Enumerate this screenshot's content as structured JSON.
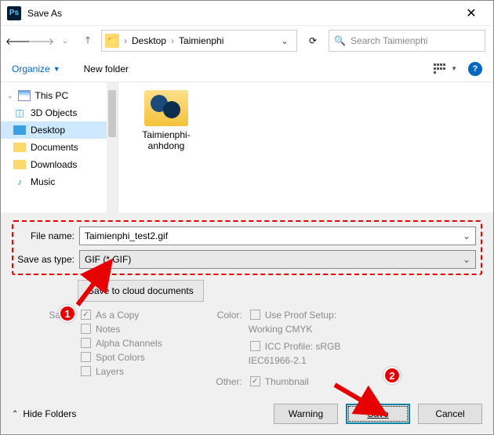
{
  "titlebar": {
    "title": "Save As",
    "app_abbr": "Ps"
  },
  "nav": {
    "breadcrumb": [
      "Desktop",
      "Taimienphi"
    ],
    "search_placeholder": "Search Taimienphi"
  },
  "toolbar": {
    "organize": "Organize",
    "new_folder": "New folder"
  },
  "sidebar": {
    "root": "This PC",
    "items": [
      "3D Objects",
      "Desktop",
      "Documents",
      "Downloads",
      "Music"
    ],
    "selected_index": 1
  },
  "content": {
    "folder_label": "Taimienphi-anhdong"
  },
  "form": {
    "filename_label": "File name:",
    "filename_value": "Taimienphi_test2.gif",
    "type_label": "Save as type:",
    "type_value": "GIF (*.GIF)",
    "cloud_btn": "Save to cloud documents",
    "save_label": "Save:",
    "save_opts": [
      "As a Copy",
      "Notes",
      "Alpha Channels",
      "Spot Colors",
      "Layers"
    ],
    "color_label": "Color:",
    "color_opt1": "Use Proof Setup:",
    "color_opt1_sub": "Working CMYK",
    "color_opt2": "ICC Profile: sRGB",
    "color_opt2_sub": "IEC61966-2.1",
    "other_label": "Other:",
    "other_opt": "Thumbnail"
  },
  "bottom": {
    "hide_folders": "Hide Folders",
    "warning": "Warning",
    "save": "Save",
    "cancel": "Cancel"
  },
  "annotations": {
    "badge1": "1",
    "badge2": "2"
  }
}
